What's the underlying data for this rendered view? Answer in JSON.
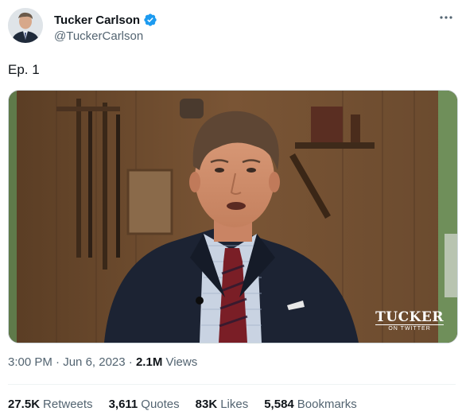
{
  "author": {
    "name": "Tucker Carlson",
    "handle": "@TuckerCarlson",
    "verified_color": "#1d9bf0"
  },
  "tweet": {
    "text": "Ep. 1"
  },
  "media": {
    "watermark_main": "TUCKER",
    "watermark_sub": "ON TWITTER"
  },
  "meta": {
    "time": "3:00 PM",
    "separator1": " · ",
    "date": "Jun 6, 2023",
    "separator2": " · ",
    "views_count": "2.1M",
    "views_label": " Views"
  },
  "stats": {
    "retweets_count": "27.5K",
    "retweets_label": "Retweets",
    "quotes_count": "3,611",
    "quotes_label": "Quotes",
    "likes_count": "83K",
    "likes_label": "Likes",
    "bookmarks_count": "5,584",
    "bookmarks_label": "Bookmarks"
  },
  "icons": {
    "more": "more-horizontal-icon",
    "verified": "verified-badge-icon"
  }
}
